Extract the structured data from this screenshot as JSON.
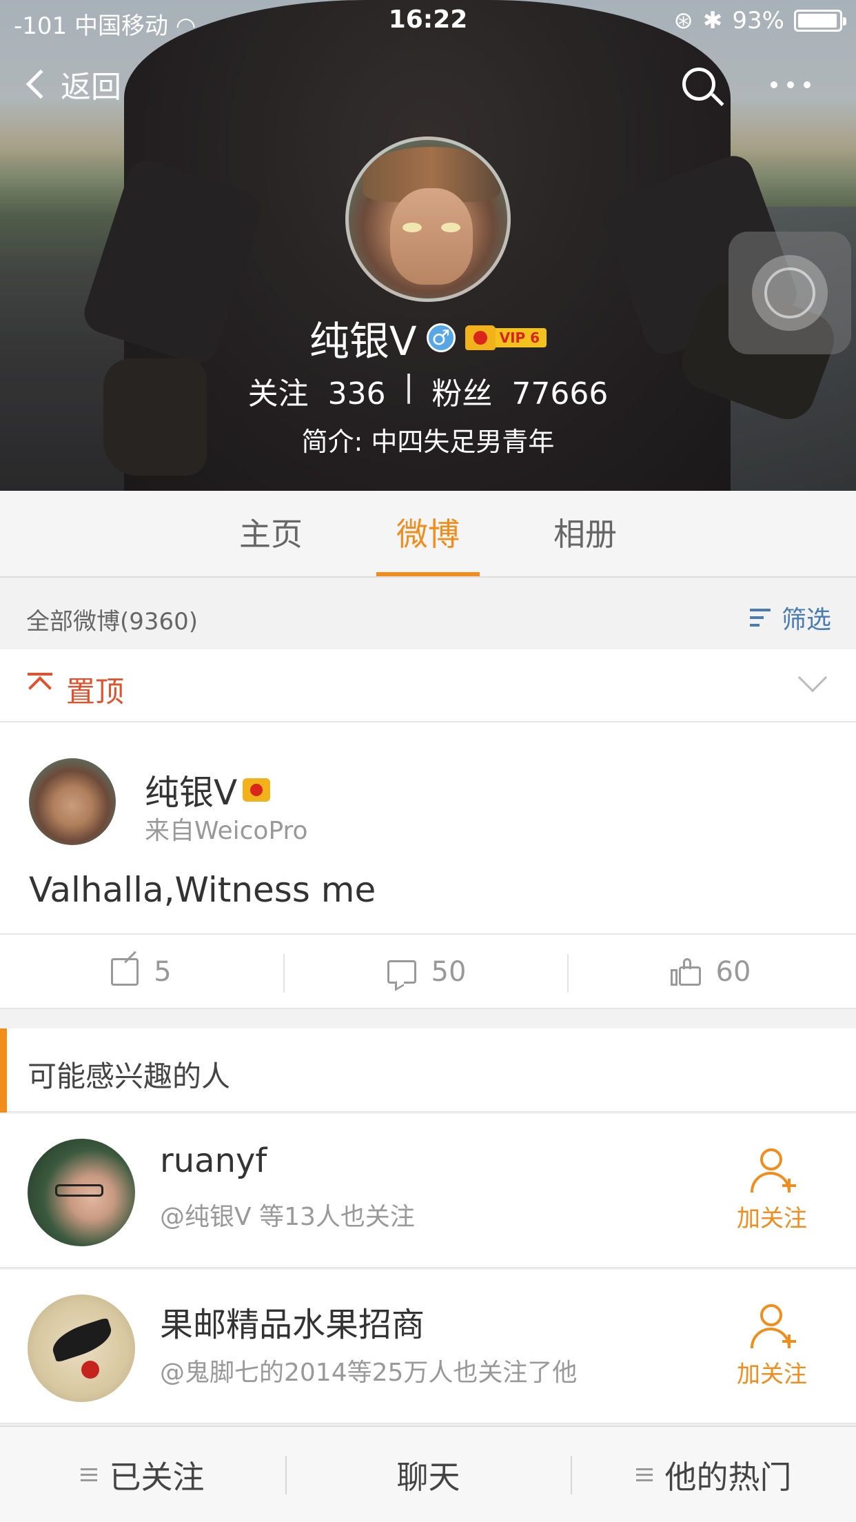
{
  "status_bar": {
    "carrier": "-101 中国移动",
    "time": "16:22",
    "battery": "93%"
  },
  "nav": {
    "back_label": "返回"
  },
  "profile": {
    "name": "纯银V",
    "gender_symbol": "♂",
    "vip_label": "VIP 6",
    "following_label": "关注",
    "following_count": "336",
    "separator": "|",
    "followers_label": "粉丝",
    "followers_count": "77666",
    "bio": "简介: 中四失足男青年"
  },
  "tabs": [
    {
      "label": "主页"
    },
    {
      "label": "微博"
    },
    {
      "label": "相册"
    }
  ],
  "active_tab": "微博",
  "filter": {
    "label": "全部微博(9360)",
    "button_label": "筛选"
  },
  "pinned": {
    "label": "置顶"
  },
  "post": {
    "author": "纯银V",
    "source": "来自WeicoPro",
    "text": "Valhalla,Witness me",
    "reposts": "5",
    "comments": "50",
    "likes": "60"
  },
  "recommend": {
    "title": "可能感兴趣的人",
    "people": [
      {
        "name": "ruanyf",
        "subtitle": "@纯银V 等13人也关注",
        "follow_label": "加关注"
      },
      {
        "name": "果邮精品水果招商",
        "subtitle": "@鬼脚七的2014等25万人也关注了他",
        "follow_label": "加关注"
      }
    ]
  },
  "bottom_bar": {
    "followed_label": "已关注",
    "chat_label": "聊天",
    "hot_label": "他的热门"
  },
  "colors": {
    "accent": "#f18d1c",
    "pinned": "#e0522d",
    "link": "#4a7cb2"
  }
}
